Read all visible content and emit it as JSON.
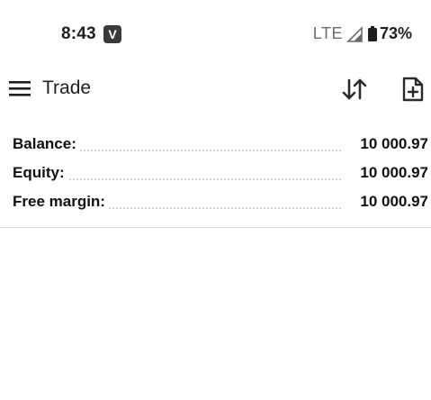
{
  "status_bar": {
    "time": "8:43",
    "app_badge": "V",
    "network": "LTE",
    "battery": "73%"
  },
  "app_bar": {
    "title": "Trade",
    "icons": [
      "menu-icon",
      "sort-icon",
      "new-order-icon"
    ]
  },
  "account": {
    "rows": [
      {
        "label": "Balance:",
        "value": "10 000.97"
      },
      {
        "label": "Equity:",
        "value": "10 000.97"
      },
      {
        "label": "Free margin:",
        "value": "10 000.97"
      }
    ]
  },
  "colors": {
    "text": "#1f1f1f",
    "divider": "#dcdcdc",
    "dots": "#cfcfcf"
  }
}
